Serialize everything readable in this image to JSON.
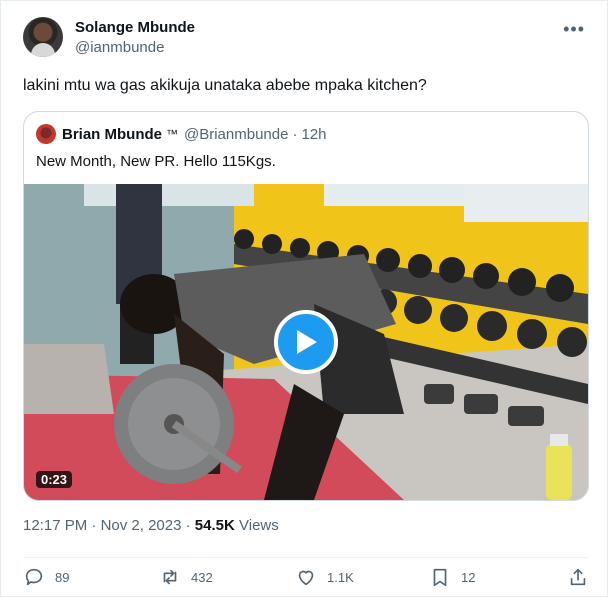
{
  "author": {
    "display_name": "Solange Mbunde",
    "handle": "@ianmbunde"
  },
  "tweet": {
    "text": "lakini mtu wa gas akikuja unataka abebe mpaka kitchen?",
    "more_icon": "more-horizontal-icon"
  },
  "quote": {
    "display_name": "Brian Mbunde",
    "badge": "™",
    "handle": "@Brianmbunde",
    "separator": "·",
    "time": "12h",
    "text": "New Month, New PR. Hello 115Kgs.",
    "video_duration": "0:23"
  },
  "meta": {
    "time": "12:17 PM",
    "sep1": "·",
    "date": "Nov 2, 2023",
    "sep2": "·",
    "views_count": "54.5K",
    "views_label": "Views"
  },
  "actions": {
    "replies": "89",
    "reposts": "432",
    "likes": "1.1K",
    "bookmarks": "12"
  },
  "colors": {
    "accent": "#1d9bf0",
    "secondary_text": "#536471"
  }
}
